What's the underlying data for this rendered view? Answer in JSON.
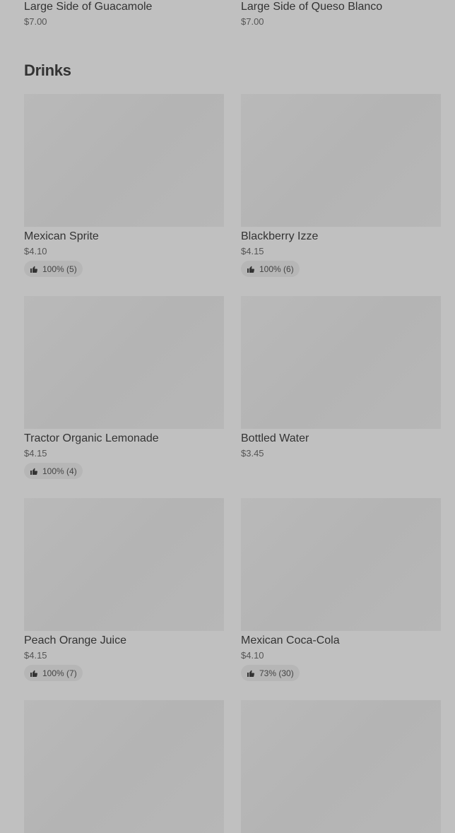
{
  "top_items": [
    {
      "name": "Large Side of Guacamole",
      "price": "$7.00"
    },
    {
      "name": "Large Side of Queso Blanco",
      "price": "$7.00"
    }
  ],
  "section": {
    "title": "Drinks"
  },
  "items": [
    {
      "name": "Mexican Sprite",
      "price": "$4.10",
      "rating": "100% (5)"
    },
    {
      "name": "Blackberry Izze",
      "price": "$4.15",
      "rating": "100% (6)"
    },
    {
      "name": "Tractor Organic Lemonade",
      "price": "$4.15",
      "rating": "100% (4)"
    },
    {
      "name": "Bottled Water",
      "price": "$3.45",
      "rating": ""
    },
    {
      "name": "Peach Orange Juice",
      "price": "$4.15",
      "rating": "100% (7)"
    },
    {
      "name": "Mexican Coca-Cola",
      "price": "$4.10",
      "rating": "73% (30)"
    }
  ],
  "icons": {
    "rating": "thumbs-up-icon"
  }
}
